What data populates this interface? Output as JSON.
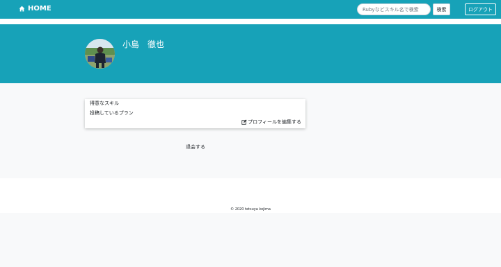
{
  "colors": {
    "accent": "#17a2b8",
    "page_background": "#f8f9fa",
    "card_background": "#ffffff"
  },
  "navbar": {
    "home_icon": "home-icon",
    "home_label": "HOME",
    "search": {
      "placeholder": "Rubyなどスキル名で検索",
      "value": ""
    },
    "search_button_label": "検索",
    "logout_label": "ログアウト"
  },
  "profile": {
    "user_name": "小島　徹也",
    "skills_heading": "得意なスキル",
    "plans_heading": "投稿しているプラン",
    "edit_icon": "edit-icon",
    "edit_label": "プロフィールを編集する"
  },
  "withdraw_label": "退会する",
  "footer": {
    "copyright": "© 2020 tetsuya kojima"
  }
}
